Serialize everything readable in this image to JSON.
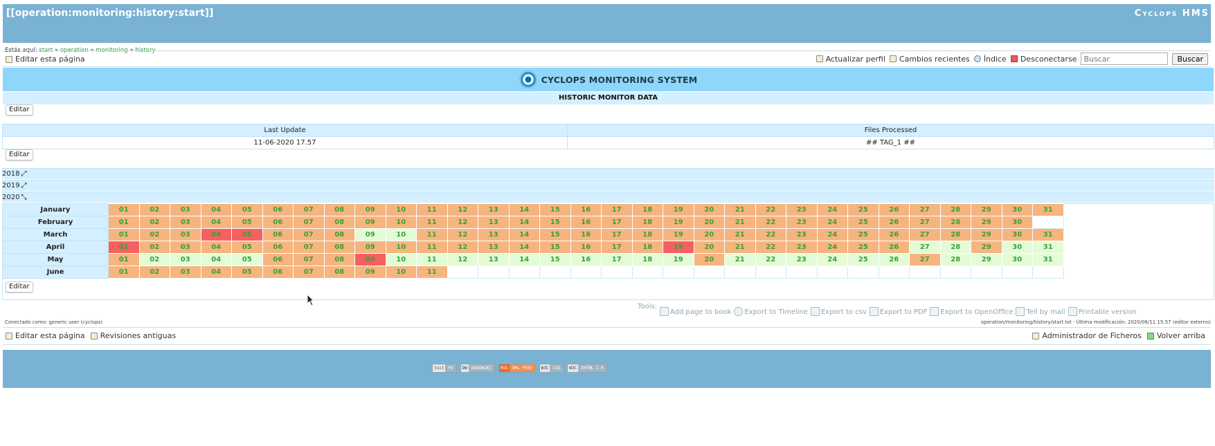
{
  "header": {
    "page_id": "[[operation:monitoring:history:start]]",
    "site_title": "Cyclops HMS"
  },
  "breadcrumb": {
    "prefix": "Estás aquí:",
    "items": [
      "start",
      "operation",
      "monitoring",
      "history"
    ],
    "separator": "»"
  },
  "page_tools": {
    "edit": "Editar esta página"
  },
  "user_tools": {
    "profile": "Actualizar perfil",
    "recent": "Cambios recientes",
    "index": "Índice",
    "logout": "Desconectarse",
    "search_placeholder": "Buscar",
    "search_button": "Buscar"
  },
  "banner": {
    "title": "CYCLOPS MONITORING SYSTEM",
    "subtitle": "HISTORIC MONITOR DATA"
  },
  "edit_label": "Editar",
  "stats": {
    "headers": [
      "Last Update",
      "Files Processed"
    ],
    "values": [
      "11-06-2020 17.57",
      "## TAG_1 ##"
    ]
  },
  "years": [
    "2018",
    "2019",
    "2020"
  ],
  "calendar": {
    "months": [
      "January",
      "February",
      "March",
      "April",
      "May",
      "June"
    ],
    "days": [
      "01",
      "02",
      "03",
      "04",
      "05",
      "06",
      "07",
      "08",
      "09",
      "10",
      "11",
      "12",
      "13",
      "14",
      "15",
      "16",
      "17",
      "18",
      "19",
      "20",
      "21",
      "22",
      "23",
      "24",
      "25",
      "26",
      "27",
      "28",
      "29",
      "30",
      "31"
    ],
    "status": {
      "January": "ooooooooooooooooooooooooooooooo",
      "February": "ooooooooooooooooooooooooooooooee",
      "March": "ooorroooggooooooooooooooooooooo",
      "April": "roooooooooooooooooroooooooggogge",
      "May": "oggggooorggggggggggoggggggoggggg",
      "June": "oooooooooooeeeeeeeeeeeeeeeeeeee"
    },
    "legend_colors": {
      "o": "#f6b47f",
      "g": "#e3fbd6",
      "r": "#f56060",
      "e": "#ffffff"
    }
  },
  "tools": {
    "label": "Tools:",
    "items": [
      "Add page to book",
      "Export to Timeline",
      "Export to csv",
      "Export to PDF",
      "Export to OpenOffice",
      "Tell by mail",
      "Printable version"
    ]
  },
  "status_line": {
    "logged_in": "Conectado como: generic user (cyclops)",
    "last_mod": "operation/monitoring/history/start.txt · Última modificación: 2020/06/11 15:57 (editor externo)"
  },
  "footer_tools": {
    "edit": "Editar esta página",
    "revisions": "Revisiones antiguas",
    "files": "Administrador de Ficheros",
    "top": "Volver arriba"
  },
  "badges": [
    {
      "left": "(cc)",
      "right": "PD"
    },
    {
      "left": "DW",
      "right": "DOKUWIKI"
    },
    {
      "left": "RSS",
      "right": "XML FEED"
    },
    {
      "left": "W3C",
      "right": "CSS"
    },
    {
      "left": "W3C",
      "right": "XHTML 1.0"
    }
  ]
}
